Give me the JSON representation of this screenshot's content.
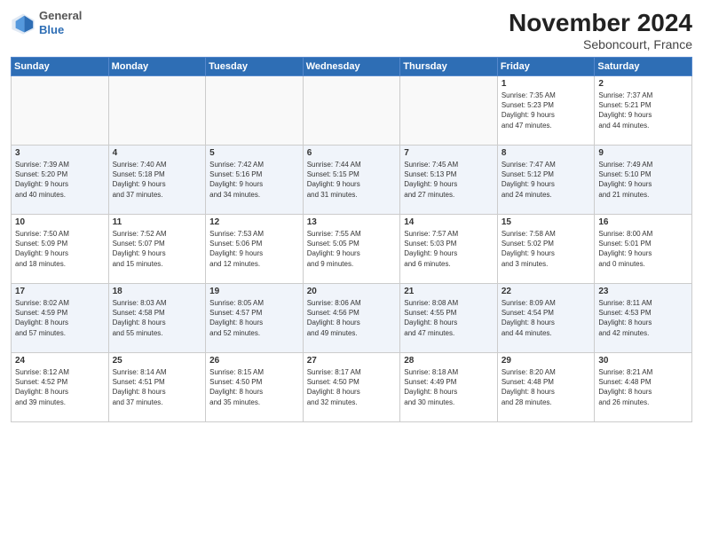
{
  "header": {
    "logo_general": "General",
    "logo_blue": "Blue",
    "month_title": "November 2024",
    "subtitle": "Seboncourt, France"
  },
  "weekdays": [
    "Sunday",
    "Monday",
    "Tuesday",
    "Wednesday",
    "Thursday",
    "Friday",
    "Saturday"
  ],
  "weeks": [
    [
      {
        "day": "",
        "info": ""
      },
      {
        "day": "",
        "info": ""
      },
      {
        "day": "",
        "info": ""
      },
      {
        "day": "",
        "info": ""
      },
      {
        "day": "",
        "info": ""
      },
      {
        "day": "1",
        "info": "Sunrise: 7:35 AM\nSunset: 5:23 PM\nDaylight: 9 hours\nand 47 minutes."
      },
      {
        "day": "2",
        "info": "Sunrise: 7:37 AM\nSunset: 5:21 PM\nDaylight: 9 hours\nand 44 minutes."
      }
    ],
    [
      {
        "day": "3",
        "info": "Sunrise: 7:39 AM\nSunset: 5:20 PM\nDaylight: 9 hours\nand 40 minutes."
      },
      {
        "day": "4",
        "info": "Sunrise: 7:40 AM\nSunset: 5:18 PM\nDaylight: 9 hours\nand 37 minutes."
      },
      {
        "day": "5",
        "info": "Sunrise: 7:42 AM\nSunset: 5:16 PM\nDaylight: 9 hours\nand 34 minutes."
      },
      {
        "day": "6",
        "info": "Sunrise: 7:44 AM\nSunset: 5:15 PM\nDaylight: 9 hours\nand 31 minutes."
      },
      {
        "day": "7",
        "info": "Sunrise: 7:45 AM\nSunset: 5:13 PM\nDaylight: 9 hours\nand 27 minutes."
      },
      {
        "day": "8",
        "info": "Sunrise: 7:47 AM\nSunset: 5:12 PM\nDaylight: 9 hours\nand 24 minutes."
      },
      {
        "day": "9",
        "info": "Sunrise: 7:49 AM\nSunset: 5:10 PM\nDaylight: 9 hours\nand 21 minutes."
      }
    ],
    [
      {
        "day": "10",
        "info": "Sunrise: 7:50 AM\nSunset: 5:09 PM\nDaylight: 9 hours\nand 18 minutes."
      },
      {
        "day": "11",
        "info": "Sunrise: 7:52 AM\nSunset: 5:07 PM\nDaylight: 9 hours\nand 15 minutes."
      },
      {
        "day": "12",
        "info": "Sunrise: 7:53 AM\nSunset: 5:06 PM\nDaylight: 9 hours\nand 12 minutes."
      },
      {
        "day": "13",
        "info": "Sunrise: 7:55 AM\nSunset: 5:05 PM\nDaylight: 9 hours\nand 9 minutes."
      },
      {
        "day": "14",
        "info": "Sunrise: 7:57 AM\nSunset: 5:03 PM\nDaylight: 9 hours\nand 6 minutes."
      },
      {
        "day": "15",
        "info": "Sunrise: 7:58 AM\nSunset: 5:02 PM\nDaylight: 9 hours\nand 3 minutes."
      },
      {
        "day": "16",
        "info": "Sunrise: 8:00 AM\nSunset: 5:01 PM\nDaylight: 9 hours\nand 0 minutes."
      }
    ],
    [
      {
        "day": "17",
        "info": "Sunrise: 8:02 AM\nSunset: 4:59 PM\nDaylight: 8 hours\nand 57 minutes."
      },
      {
        "day": "18",
        "info": "Sunrise: 8:03 AM\nSunset: 4:58 PM\nDaylight: 8 hours\nand 55 minutes."
      },
      {
        "day": "19",
        "info": "Sunrise: 8:05 AM\nSunset: 4:57 PM\nDaylight: 8 hours\nand 52 minutes."
      },
      {
        "day": "20",
        "info": "Sunrise: 8:06 AM\nSunset: 4:56 PM\nDaylight: 8 hours\nand 49 minutes."
      },
      {
        "day": "21",
        "info": "Sunrise: 8:08 AM\nSunset: 4:55 PM\nDaylight: 8 hours\nand 47 minutes."
      },
      {
        "day": "22",
        "info": "Sunrise: 8:09 AM\nSunset: 4:54 PM\nDaylight: 8 hours\nand 44 minutes."
      },
      {
        "day": "23",
        "info": "Sunrise: 8:11 AM\nSunset: 4:53 PM\nDaylight: 8 hours\nand 42 minutes."
      }
    ],
    [
      {
        "day": "24",
        "info": "Sunrise: 8:12 AM\nSunset: 4:52 PM\nDaylight: 8 hours\nand 39 minutes."
      },
      {
        "day": "25",
        "info": "Sunrise: 8:14 AM\nSunset: 4:51 PM\nDaylight: 8 hours\nand 37 minutes."
      },
      {
        "day": "26",
        "info": "Sunrise: 8:15 AM\nSunset: 4:50 PM\nDaylight: 8 hours\nand 35 minutes."
      },
      {
        "day": "27",
        "info": "Sunrise: 8:17 AM\nSunset: 4:50 PM\nDaylight: 8 hours\nand 32 minutes."
      },
      {
        "day": "28",
        "info": "Sunrise: 8:18 AM\nSunset: 4:49 PM\nDaylight: 8 hours\nand 30 minutes."
      },
      {
        "day": "29",
        "info": "Sunrise: 8:20 AM\nSunset: 4:48 PM\nDaylight: 8 hours\nand 28 minutes."
      },
      {
        "day": "30",
        "info": "Sunrise: 8:21 AM\nSunset: 4:48 PM\nDaylight: 8 hours\nand 26 minutes."
      }
    ]
  ]
}
